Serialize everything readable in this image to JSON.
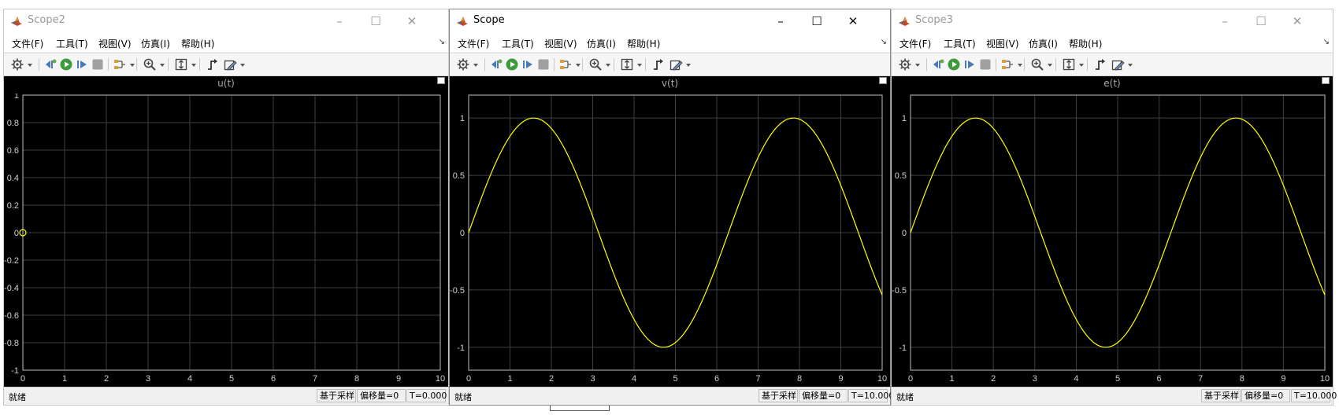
{
  "menu": [
    "文件(F)",
    "工具(T)",
    "视图(V)",
    "仿真(I)",
    "帮助(H)"
  ],
  "status_left": "就绪",
  "status_mode": "基于采样",
  "status_offset": "偏移量=0",
  "colors": {
    "trace": "#ffff00",
    "grid": "#404040",
    "axes": "#bfbfbf",
    "ticktext": "#d0d0d0",
    "background": "#000000"
  },
  "windows": [
    {
      "title": "Scope2",
      "active": false,
      "plot_title": "u(t)",
      "status_time": "T=0.000",
      "chart_data": {
        "type": "line",
        "title": "u(t)",
        "xlim": [
          0,
          10
        ],
        "ylim": [
          -1,
          1
        ],
        "x_ticks": [
          "0",
          "1",
          "2",
          "3",
          "4",
          "5",
          "6",
          "7",
          "8",
          "9",
          "10"
        ],
        "y_ticks": [
          "-1",
          "-0.8",
          "-0.6",
          "-0.4",
          "-0.2",
          "0",
          "0.2",
          "0.4",
          "0.6",
          "0.8",
          "1"
        ],
        "series": [
          {
            "function": "point",
            "x": [
              0
            ],
            "y": [
              0
            ]
          }
        ]
      }
    },
    {
      "title": "Scope",
      "active": true,
      "plot_title": "v(t)",
      "status_time": "T=10.000",
      "chart_data": {
        "type": "line",
        "title": "v(t)",
        "xlim": [
          0,
          10
        ],
        "ylim": [
          -1.2,
          1.2
        ],
        "x_ticks": [
          "0",
          "1",
          "2",
          "3",
          "4",
          "5",
          "6",
          "7",
          "8",
          "9",
          "10"
        ],
        "y_ticks": [
          "-1",
          "-0.5",
          "0",
          "0.5",
          "1"
        ],
        "series": [
          {
            "function": "sin",
            "x_range": [
              0,
              10
            ]
          }
        ]
      }
    },
    {
      "title": "Scope3",
      "active": false,
      "plot_title": "e(t)",
      "status_time": "T=10.000",
      "chart_data": {
        "type": "line",
        "title": "e(t)",
        "xlim": [
          0,
          10
        ],
        "ylim": [
          -1.2,
          1.2
        ],
        "x_ticks": [
          "0",
          "1",
          "2",
          "3",
          "4",
          "5",
          "6",
          "7",
          "8",
          "9",
          "10"
        ],
        "y_ticks": [
          "-1",
          "-0.5",
          "0",
          "0.5",
          "1"
        ],
        "series": [
          {
            "function": "sin",
            "x_range": [
              0,
              10
            ]
          }
        ]
      }
    }
  ]
}
